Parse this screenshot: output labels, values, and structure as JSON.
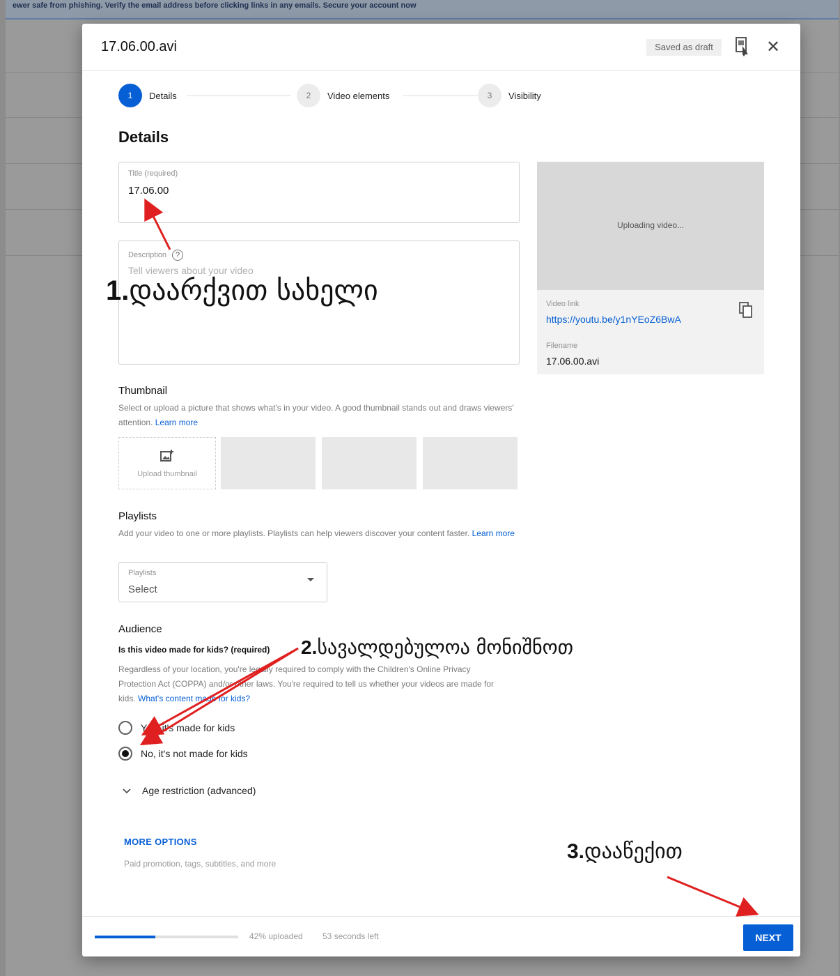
{
  "background": {
    "banner_text": "ewer safe from phishing. Verify the email address before clicking links in any emails. Secure your account now"
  },
  "dialog": {
    "title": "17.06.00.avi",
    "saved_status": "Saved as draft",
    "icons": {
      "feedback": "feedback-icon",
      "close": "close-icon"
    }
  },
  "stepper": {
    "steps": [
      {
        "number": "1",
        "label": "Details",
        "active": true
      },
      {
        "number": "2",
        "label": "Video elements",
        "active": false
      },
      {
        "number": "3",
        "label": "Visibility",
        "active": false
      }
    ]
  },
  "details": {
    "section_title": "Details",
    "title_field": {
      "label": "Title (required)",
      "value": "17.06.00"
    },
    "description_field": {
      "label": "Description",
      "placeholder": "Tell viewers about your video"
    }
  },
  "preview": {
    "status": "Uploading video...",
    "video_link_label": "Video link",
    "video_link": "https://youtu.be/y1nYEoZ6BwA",
    "filename_label": "Filename",
    "filename": "17.06.00.avi"
  },
  "thumbnail": {
    "heading": "Thumbnail",
    "description": "Select or upload a picture that shows what's in your video. A good thumbnail stands out and draws viewers' attention.",
    "learn_more": "Learn more",
    "upload_label": "Upload thumbnail"
  },
  "playlists": {
    "heading": "Playlists",
    "description": "Add your video to one or more playlists. Playlists can help viewers discover your content faster.",
    "learn_more": "Learn more",
    "select_label": "Playlists",
    "select_value": "Select"
  },
  "audience": {
    "heading": "Audience",
    "question": "Is this video made for kids? (required)",
    "description": "Regardless of your location, you're legally required to comply with the Children's Online Privacy Protection Act (COPPA) and/or other laws. You're required to tell us whether your videos are made for kids.",
    "link": "What's content made for kids?",
    "options": [
      {
        "label": "Yes, it's made for kids",
        "checked": false
      },
      {
        "label": "No, it's not made for kids",
        "checked": true
      }
    ],
    "age_restriction": "Age restriction (advanced)"
  },
  "more_options": {
    "label": "MORE OPTIONS",
    "description": "Paid promotion, tags, subtitles, and more"
  },
  "footer": {
    "upload_progress": 0.42,
    "status": "42% uploaded",
    "time_left": "53 seconds left",
    "next_label": "NEXT"
  },
  "annotations": [
    {
      "number": "1.",
      "text": "დაარქვით სახელი"
    },
    {
      "number": "2.",
      "text": "სავალდებულოა მონიშნოთ"
    },
    {
      "number": "3.",
      "text": "დააწექით"
    }
  ],
  "colors": {
    "accent": "#065fd4",
    "arrow": "#e02020"
  }
}
